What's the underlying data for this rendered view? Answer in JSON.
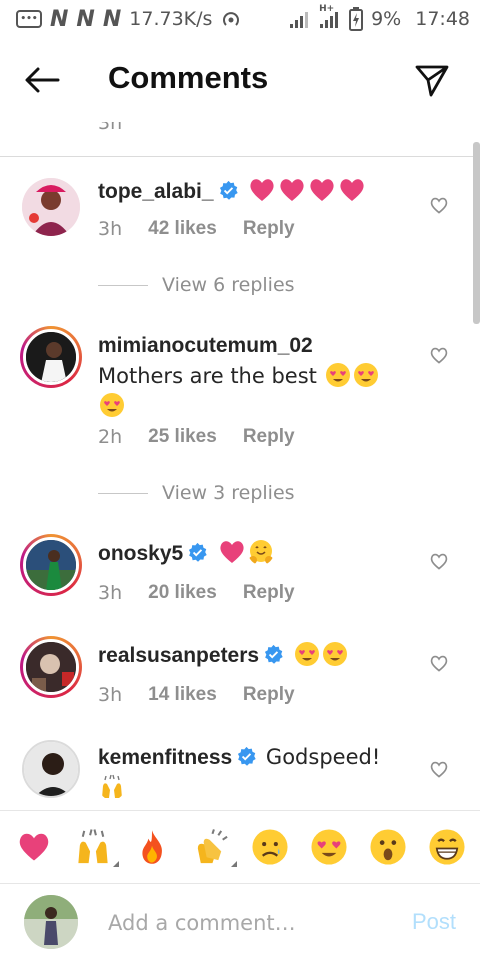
{
  "status_bar": {
    "network_speed": "17.73K/s",
    "network_type": "H+",
    "battery": "9%",
    "time": "17:48",
    "icons": [
      "message-icon",
      "n-icon",
      "n-icon",
      "n-icon",
      "hotspot-icon",
      "signal-icon",
      "signal-icon",
      "battery-charging-icon"
    ]
  },
  "header": {
    "title": "Comments",
    "back_icon": "arrow-left-icon",
    "send_icon": "paper-plane-icon"
  },
  "list": {
    "peek_time": "3h",
    "comments": [
      {
        "username": "tope_alabi_",
        "verified": true,
        "text": "",
        "emojis": [
          "pink-heart",
          "pink-heart",
          "pink-heart",
          "pink-heart"
        ],
        "time": "3h",
        "likes": "42 likes",
        "reply": "Reply",
        "view_replies": "View 6 replies"
      },
      {
        "username": "mimianocutemum_02",
        "verified": false,
        "text": "Mothers are the best",
        "emojis": [
          "heart-eyes",
          "heart-eyes",
          "heart-eyes"
        ],
        "time": "2h",
        "likes": "25 likes",
        "reply": "Reply",
        "view_replies": "View 3 replies"
      },
      {
        "username": "onosky5",
        "verified": true,
        "text": "",
        "emojis": [
          "pink-heart",
          "hugging-face"
        ],
        "time": "3h",
        "likes": "20 likes",
        "reply": "Reply"
      },
      {
        "username": "realsusanpeters",
        "verified": true,
        "text": "",
        "emojis": [
          "heart-eyes",
          "heart-eyes"
        ],
        "time": "3h",
        "likes": "14 likes",
        "reply": "Reply"
      },
      {
        "username": "kemenfitness",
        "verified": true,
        "text": "Godspeed!",
        "emojis": [
          "raising-hands"
        ]
      }
    ]
  },
  "emoji_bar": [
    "pink-heart",
    "raising-hands",
    "fire",
    "clapping-hands",
    "crying-face",
    "heart-eyes",
    "surprised-face",
    "grinning-face"
  ],
  "composer": {
    "placeholder": "Add a comment…",
    "post_label": "Post"
  },
  "colors": {
    "accent_blue": "#3897f0",
    "post_disabled": "#b2dffc",
    "muted_text": "#8e8e8e",
    "heart_pink": "#e8417a",
    "emoji_yellow": "#ffcc33"
  }
}
